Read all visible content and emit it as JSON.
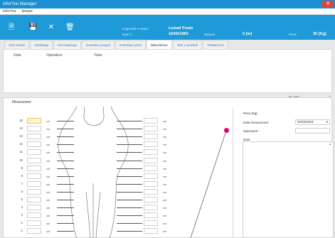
{
  "window": {
    "title": "InforYou Manager",
    "close_icon": "close-icon"
  },
  "menu": {
    "items": [
      "InforYou",
      "Ipropie"
    ]
  },
  "toolbar": {
    "icons": [
      "document-icon",
      "save-icon",
      "close-icon",
      "trash-icon"
    ],
    "name_label": "Cognome e nome:",
    "name_value": "Lemail Prado",
    "num_label": "Num 1:",
    "birth_value": "16/05/1983",
    "height_label": "Statura:",
    "height_value": "0 [m]",
    "weight_label": "Peso:",
    "weight_value": "35 [Kg]"
  },
  "tabs": [
    "Test medici",
    "Dietologa",
    "Dermatologo",
    "Estetista (corpo)",
    "Estetista (viso)",
    "Misurazioni",
    "Test e prodotti",
    "Trattamenti"
  ],
  "active_tab": 5,
  "table": {
    "columns": [
      "Data",
      "Operatore",
      "Note"
    ],
    "count_label": "Nr. test:",
    "count_value": "1"
  },
  "section": {
    "title": "Misurazione"
  },
  "rows": [
    {
      "n": "15",
      "unit": "cm"
    },
    {
      "n": "14",
      "unit": "cm"
    },
    {
      "n": "13",
      "unit": "cm"
    },
    {
      "n": "12",
      "unit": "cm"
    },
    {
      "n": "11",
      "unit": "cm"
    },
    {
      "n": "10",
      "unit": "cm"
    },
    {
      "n": "9",
      "unit": "cm"
    },
    {
      "n": "8",
      "unit": "cm"
    },
    {
      "n": "7",
      "unit": "cm"
    },
    {
      "n": "6",
      "unit": "cm"
    },
    {
      "n": "5",
      "unit": "cm"
    },
    {
      "n": "4",
      "unit": "cm"
    },
    {
      "n": "3",
      "unit": "cm"
    },
    {
      "n": "2",
      "unit": "cm"
    },
    {
      "n": "1",
      "unit": "cm"
    }
  ],
  "form": {
    "peso_label": "Peso [Kg]",
    "date_label": "Data misurazione:",
    "date_value": "01/02/2019",
    "operator_label": "Operatore :",
    "notes_label": "Note"
  },
  "colors": {
    "title_bar": "#1a8fd1",
    "toolbar": "#1e9ad8",
    "highlight": "#fff6c8",
    "pointer": "#e6007e"
  }
}
